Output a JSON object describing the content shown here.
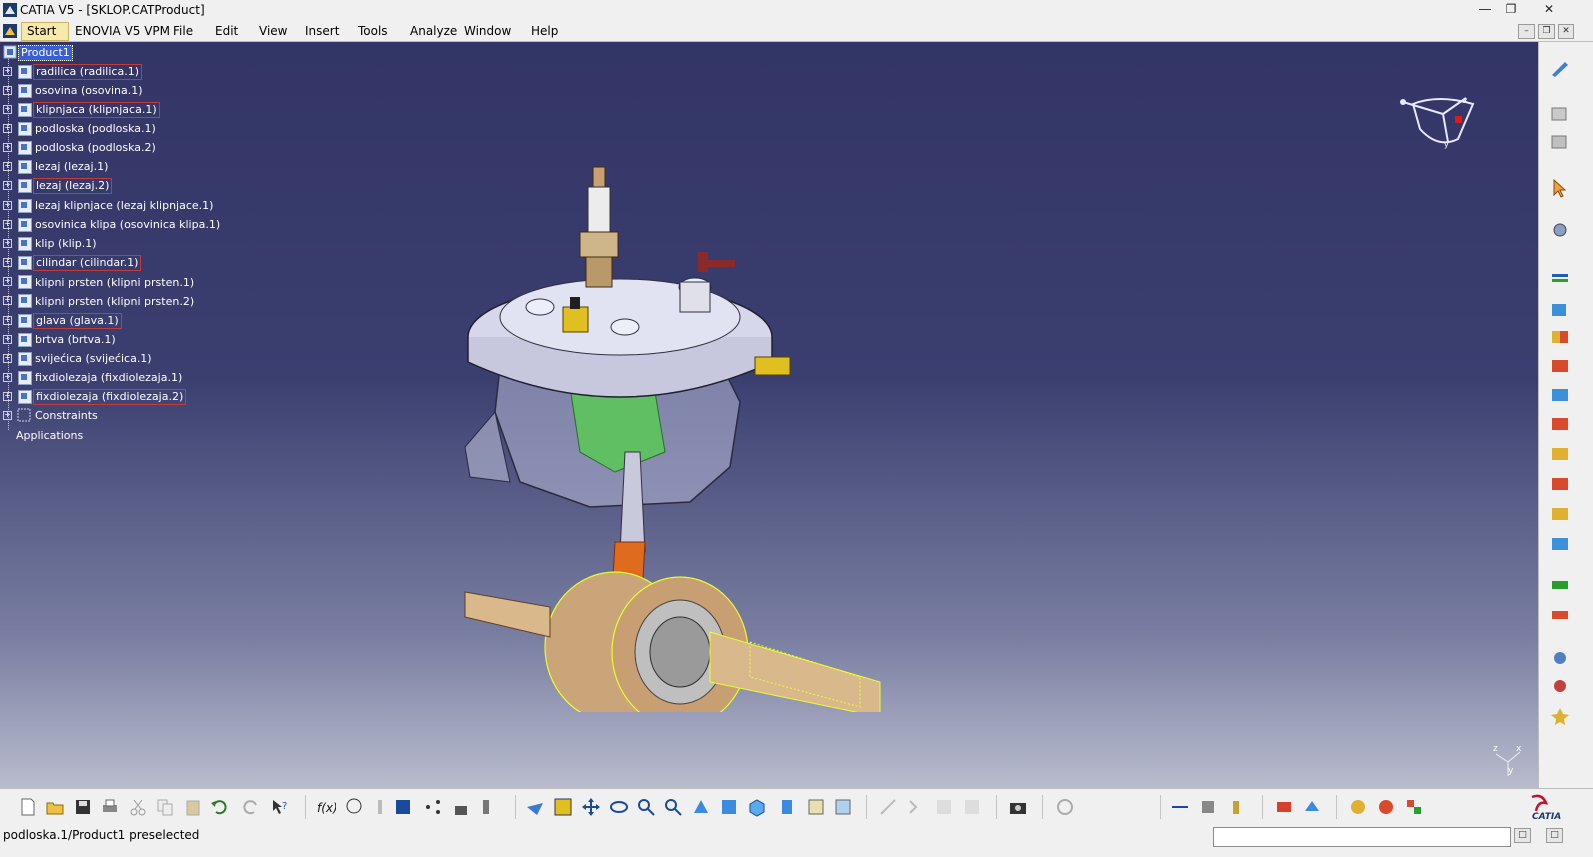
{
  "window": {
    "title": "CATIA V5 - [SKLOP.CATProduct]",
    "controls": [
      "minimize",
      "restore",
      "close"
    ]
  },
  "menubar": {
    "items": [
      "Start",
      "ENOVIA V5 VPM",
      "File",
      "Edit",
      "View",
      "Insert",
      "Tools",
      "Analyze",
      "Window",
      "Help"
    ]
  },
  "tree": {
    "root": "Product1",
    "items": [
      "radilica (radilica.1)",
      "osovina (osovina.1)",
      "klipnjaca (klipnjaca.1)",
      "podloska (podloska.1)",
      "podloska (podloska.2)",
      "lezaj (lezaj.1)",
      "lezaj (lezaj.2)",
      "lezaj klipnjace (lezaj klipnjace.1)",
      "osovinica klipa (osovinica klipa.1)",
      "klip (klip.1)",
      "cilindar (cilindar.1)",
      "klipni prsten (klipni prsten.1)",
      "klipni prsten (klipni prsten.2)",
      "glava (glava.1)",
      "brtva (brtva.1)",
      "svijećica (svijećica.1)",
      "fixdiolezaja (fixdiolezaja.1)",
      "fixdiolezaja (fixdiolezaja.2)"
    ],
    "constraints": "Constraints",
    "applications": "Applications"
  },
  "compass_axes": [
    "x",
    "y",
    "z"
  ],
  "status": {
    "message": "podloska.1/Product1 preselected",
    "command_input": ""
  },
  "colors": {
    "viewport_top": "#323565",
    "viewport_bottom": "#b9bccd",
    "tree_text": "#ffffff",
    "selection": "#3a5fd0",
    "preselect_box": "#c23a3a"
  },
  "bottom_toolbar_icons": [
    "new-icon",
    "open-icon",
    "save-icon",
    "print-icon",
    "cut-icon",
    "copy-icon",
    "paste-icon",
    "undo-icon",
    "redo-icon",
    "whats-this-icon",
    "formula-icon",
    "knowledge-icon",
    "catalog-icon",
    "table-icon",
    "graph-icon",
    "lock-icon",
    "ruler-icon",
    "fly-icon",
    "fit-all-icon",
    "pan-icon",
    "rotate-icon",
    "zoom-in-icon",
    "zoom-out-icon",
    "normal-view-icon",
    "views-icon",
    "quick-view-icon",
    "render-style-icon",
    "hide-show-icon",
    "swap-space-icon",
    "camera-icon",
    "refresh-icon",
    "measure-icon",
    "inertia-icon",
    "apply-material-icon",
    "analysis-icon",
    "update-icon",
    "constraint-icon",
    "manip-icon"
  ],
  "right_toolbar_icons": [
    "sketch-icon",
    "product-icon",
    "component-icon",
    "select-icon",
    "snap-icon",
    "coincidence-icon",
    "contact-icon",
    "offset-icon",
    "angle-icon",
    "fix-icon",
    "fix-together-icon",
    "quick-constraint-icon",
    "flexible-icon",
    "change-constraint-icon",
    "reuse-pattern-icon",
    "explode-icon",
    "manipulation-icon",
    "clash-icon",
    "bill-icon",
    "scene-icon",
    "assembly-features-icon"
  ]
}
